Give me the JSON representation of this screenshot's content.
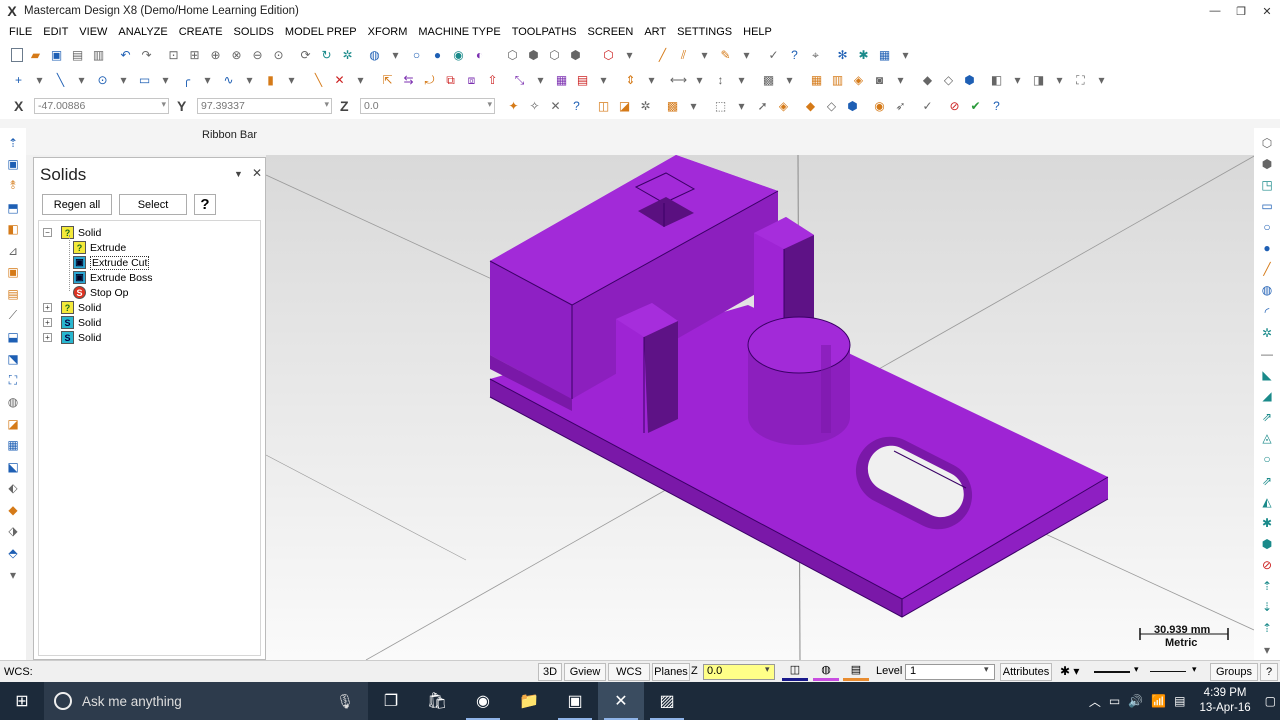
{
  "window": {
    "title": "Mastercam Design X8 (Demo/Home Learning Edition)",
    "minimize": "—",
    "restore": "❐",
    "close": "✕"
  },
  "menu": [
    {
      "label": "FILE",
      "name": "menu-file"
    },
    {
      "label": "EDIT",
      "name": "menu-edit"
    },
    {
      "label": "VIEW",
      "name": "menu-view"
    },
    {
      "label": "ANALYZE",
      "name": "menu-analyze"
    },
    {
      "label": "CREATE",
      "name": "menu-create"
    },
    {
      "label": "SOLIDS",
      "name": "menu-solids"
    },
    {
      "label": "MODEL PREP",
      "name": "menu-model-prep"
    },
    {
      "label": "XFORM",
      "name": "menu-xform"
    },
    {
      "label": "MACHINE TYPE",
      "name": "menu-machine-type"
    },
    {
      "label": "TOOLPATHS",
      "name": "menu-toolpaths"
    },
    {
      "label": "SCREEN",
      "name": "menu-screen"
    },
    {
      "label": "ART",
      "name": "menu-art"
    },
    {
      "label": "SETTINGS",
      "name": "menu-settings"
    },
    {
      "label": "HELP",
      "name": "menu-help"
    }
  ],
  "coords": {
    "x_label": "X",
    "x_value": "-47.00886",
    "y_label": "Y",
    "y_value": "97.39337",
    "z_label": "Z",
    "z_value": "0.0"
  },
  "ribbon": {
    "label": "Ribbon Bar"
  },
  "panel": {
    "title": "Solids",
    "regen_label": "Regen all",
    "select_label": "Select",
    "help_label": "?",
    "tree": [
      {
        "label": "Solid",
        "icon": "solid-icon",
        "level": 0,
        "expander": "−"
      },
      {
        "label": "Extrude",
        "icon": "extrude-icon",
        "level": 1
      },
      {
        "label": "Extrude Cut",
        "icon": "extrude-cut-icon",
        "level": 1,
        "selected": true
      },
      {
        "label": "Extrude Boss",
        "icon": "extrude-boss-icon",
        "level": 1
      },
      {
        "label": "Stop Op",
        "icon": "stop-op-icon",
        "level": 1
      },
      {
        "label": "Solid",
        "icon": "solid-icon",
        "level": 0,
        "expander": "+"
      },
      {
        "label": "Solid",
        "icon": "solid-icon",
        "level": 0,
        "expander": "+"
      },
      {
        "label": "Solid",
        "icon": "solid-icon",
        "level": 0,
        "expander": "+"
      }
    ]
  },
  "viewport": {
    "scale_value": "30.939 mm",
    "scale_unit": "Metric",
    "part_color": "#9b1fcf"
  },
  "status": {
    "wcs_left": "WCS:",
    "btn_3d": "3D",
    "btn_gview": "Gview",
    "btn_wcs": "WCS",
    "btn_planes": "Planes",
    "z_label": "Z",
    "z_value": "0.0",
    "level_label": "Level",
    "level_value": "1",
    "attributes": "Attributes",
    "groups": "Groups",
    "help": "?"
  },
  "taskbar": {
    "search_placeholder": "Ask me anything",
    "time": "4:39 PM",
    "date": "13-Apr-16"
  }
}
